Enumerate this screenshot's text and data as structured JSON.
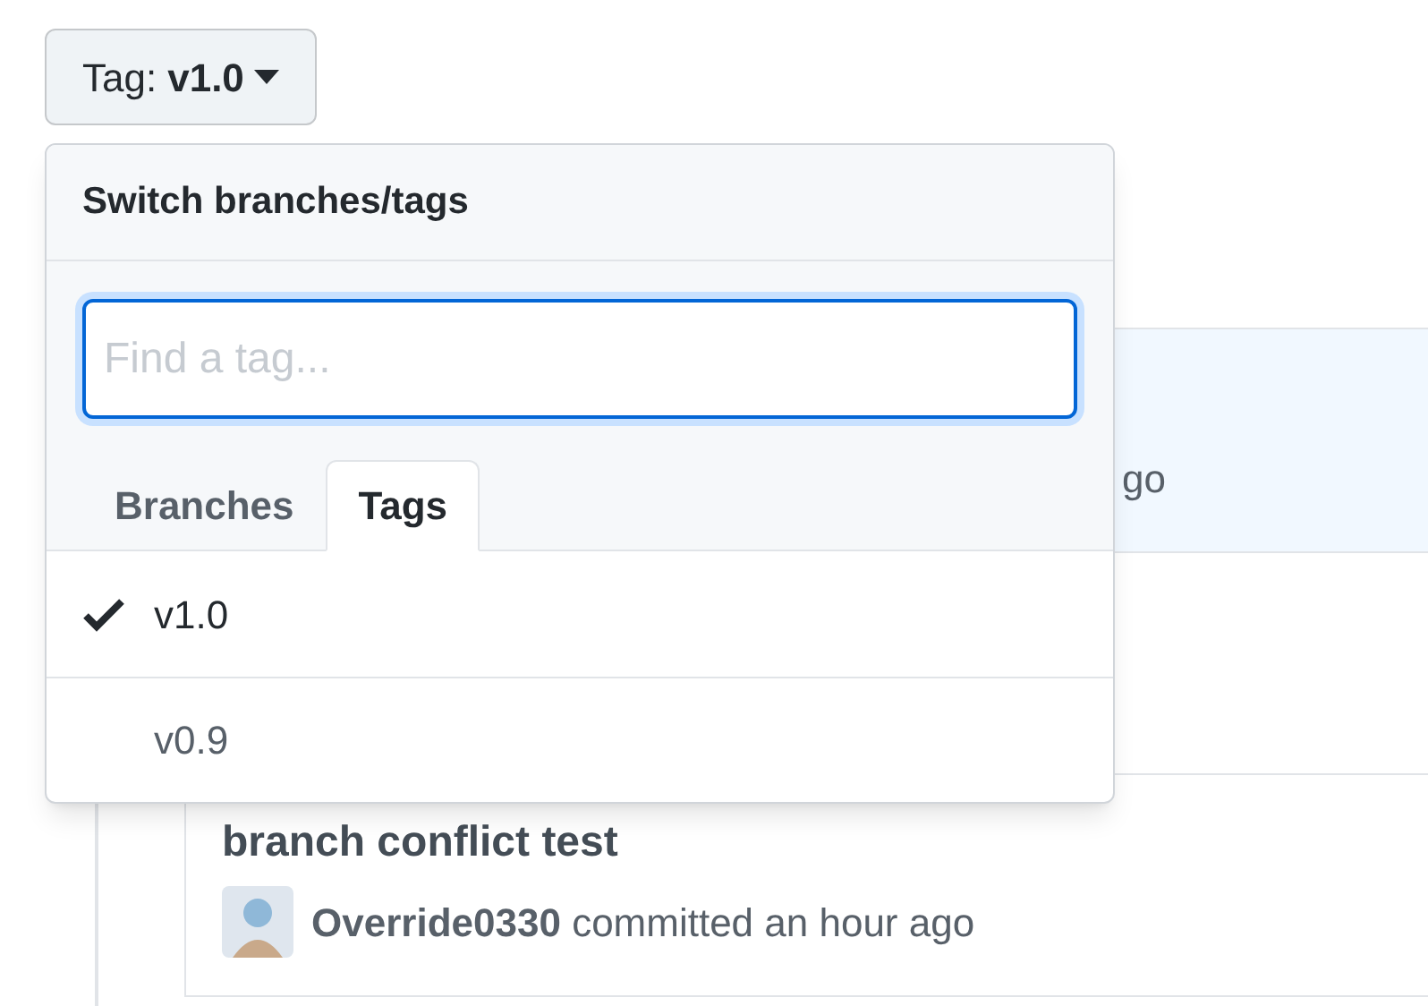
{
  "tag_button": {
    "label": "Tag:",
    "value": "v1.0"
  },
  "menu": {
    "title": "Switch branches/tags",
    "search": {
      "placeholder": "Find a tag..."
    },
    "tabs": [
      {
        "label": "Branches",
        "selected": false
      },
      {
        "label": "Tags",
        "selected": true
      }
    ],
    "items": [
      {
        "label": "v1.0",
        "selected": true
      },
      {
        "label": "v0.9",
        "selected": false
      }
    ]
  },
  "commits": [
    {
      "kind": "cut",
      "text": "go"
    },
    {
      "kind": "covered"
    },
    {
      "kind": "full",
      "title": "branch conflict test",
      "author": "Override0330",
      "action": "committed an hour ago"
    }
  ]
}
